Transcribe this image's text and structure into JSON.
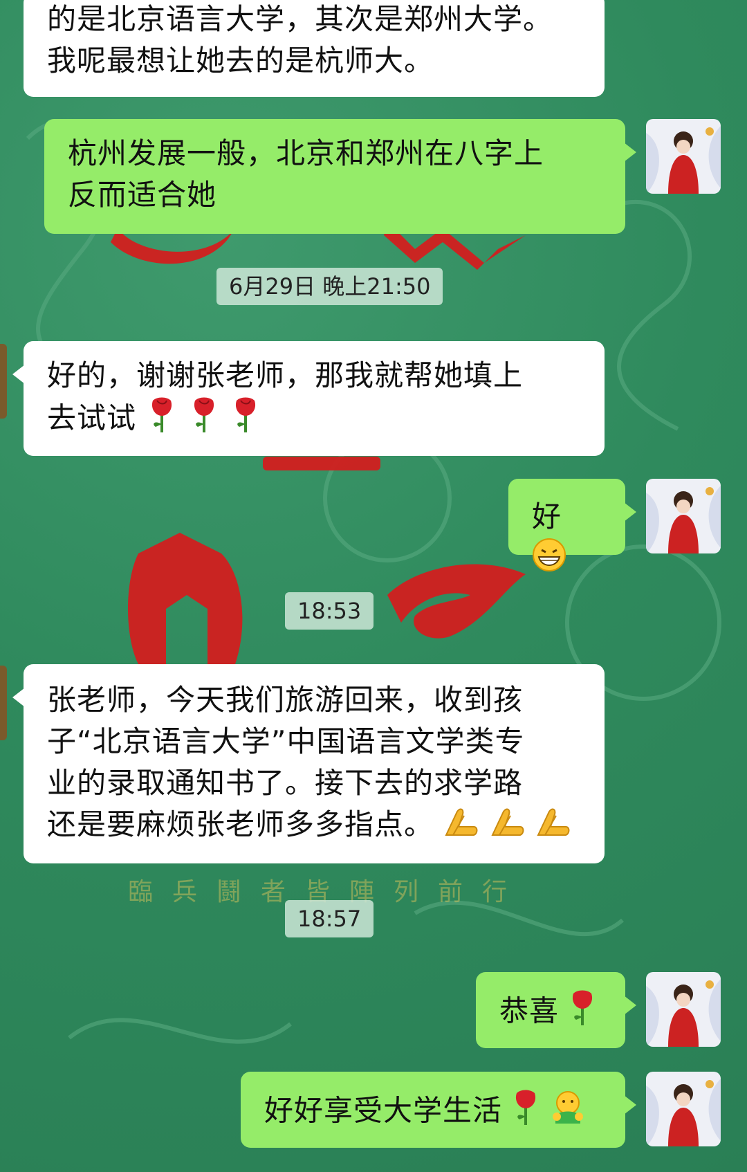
{
  "background": {
    "color": "#2f8a5d",
    "motto": "臨兵鬪者皆陣列前行"
  },
  "timestamps": [
    "6月29日 晚上21:50",
    "18:53",
    "18:57"
  ],
  "messages": [
    {
      "side": "in",
      "lines": [
        "的是北京语言大学，其次是郑州大学。",
        "我呢最想让她去的是杭师大。"
      ]
    },
    {
      "side": "out",
      "lines": [
        "杭州发展一般，北京和郑州在八字上",
        "反而适合她"
      ]
    },
    {
      "side": "in",
      "lines": [
        "好的，谢谢张老师，那我就帮她填上",
        "去试试"
      ],
      "emoji": [
        "rose-icon",
        "rose-icon",
        "rose-icon"
      ]
    },
    {
      "side": "out",
      "lines": [
        "好"
      ],
      "emoji": [
        "grin-emoji-icon"
      ]
    },
    {
      "side": "in",
      "lines": [
        "张老师，今天我们旅游回来，收到孩",
        "子“北京语言大学”中国语言文学类专",
        "业的录取通知书了。接下去的求学路",
        "还是要麻烦张老师多多指点。"
      ],
      "emoji": [
        "pray-hands-icon",
        "pray-hands-icon",
        "pray-hands-icon"
      ]
    },
    {
      "side": "out",
      "lines": [
        "恭喜"
      ],
      "emoji": [
        "rose-icon"
      ]
    },
    {
      "side": "out",
      "lines": [
        "好好享受大学生活"
      ],
      "emoji": [
        "rose-icon",
        "hug-emoji-icon"
      ]
    }
  ],
  "colors": {
    "incoming": "#ffffff",
    "outgoing": "#95ec69",
    "timestamp_bg": "#cde6d7"
  }
}
